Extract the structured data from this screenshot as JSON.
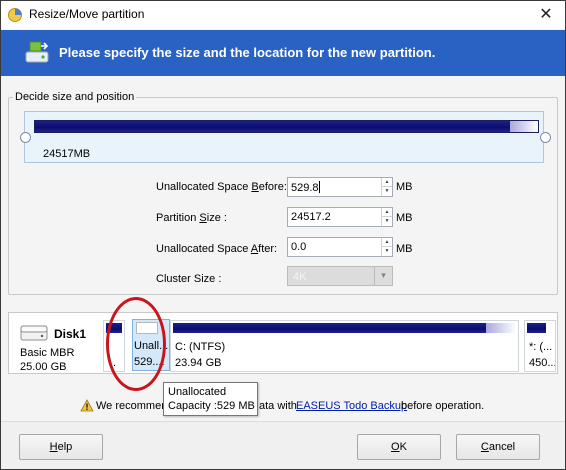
{
  "window": {
    "title": "Resize/Move partition",
    "close_glyph": "✕"
  },
  "header": {
    "text": "Please specify the size and the location for the new partition."
  },
  "group": {
    "legend": "Decide size and position"
  },
  "partition_bar": {
    "size_label": "24517MB"
  },
  "form": {
    "before_label_pre": "Unallocated Space ",
    "before_label_ul": "B",
    "before_label_post": "efore:",
    "before_value": "529.8",
    "size_label_pre": "Partition ",
    "size_label_ul": "S",
    "size_label_post": "ize :",
    "size_value": "24517.2",
    "after_label_pre": "Unallocated Space ",
    "after_label_ul": "A",
    "after_label_post": "fter:",
    "after_value": "0.0",
    "cluster_label": "Cluster Size :",
    "cluster_value": "4K",
    "unit": "MB"
  },
  "diskmap": {
    "disk_name": "Disk1",
    "disk_type": "Basic MBR",
    "disk_size": "25.00 GB",
    "small_block_dots": "..",
    "unalloc_label": "Unall...",
    "unalloc_size": "529....",
    "c_label": "C: (NTFS)",
    "c_size": "23.94 GB",
    "last_label": "*: (...",
    "last_size": "450..."
  },
  "tooltip": {
    "line1": "Unallocated",
    "line2": "Capacity :529 MB"
  },
  "warning": {
    "text": "We recommen",
    "text_mid": "ata with",
    "link": "EASEUS Todo Backup",
    "tail": "before operation."
  },
  "buttons": {
    "help": "Help",
    "help_ul": "H",
    "ok": "OK",
    "ok_ul": "O",
    "cancel": "Cancel",
    "cancel_ul": "C"
  },
  "colors": {
    "header_bg": "#2a62c3",
    "partition_fill": "#0a0d6e",
    "annotation_circle": "#c8151c"
  }
}
